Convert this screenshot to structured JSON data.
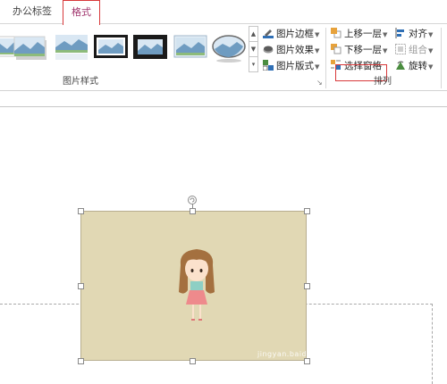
{
  "tabs": {
    "office": "办公标签",
    "format": "格式"
  },
  "picture_styles": {
    "group_label": "图片样式",
    "gallery_items": [
      "simple-frame-style",
      "shadow-style",
      "reflected-style",
      "black-frame-style",
      "thick-black-frame-style",
      "soft-edge-style",
      "oval-style"
    ],
    "border": "图片边框",
    "effects": "图片效果",
    "layout": "图片版式"
  },
  "arrange": {
    "group_label": "排列",
    "bring_forward": "上移一层",
    "send_backward": "下移一层",
    "selection_pane": "选择窗格",
    "align": "对齐",
    "group": "组合",
    "rotate": "旋转"
  },
  "watermark": "jingyan.baidu.com",
  "colors": {
    "highlight": "#d8383a",
    "format_tab_text": "#a0336c",
    "picture_bg": "#e1d8b4"
  }
}
